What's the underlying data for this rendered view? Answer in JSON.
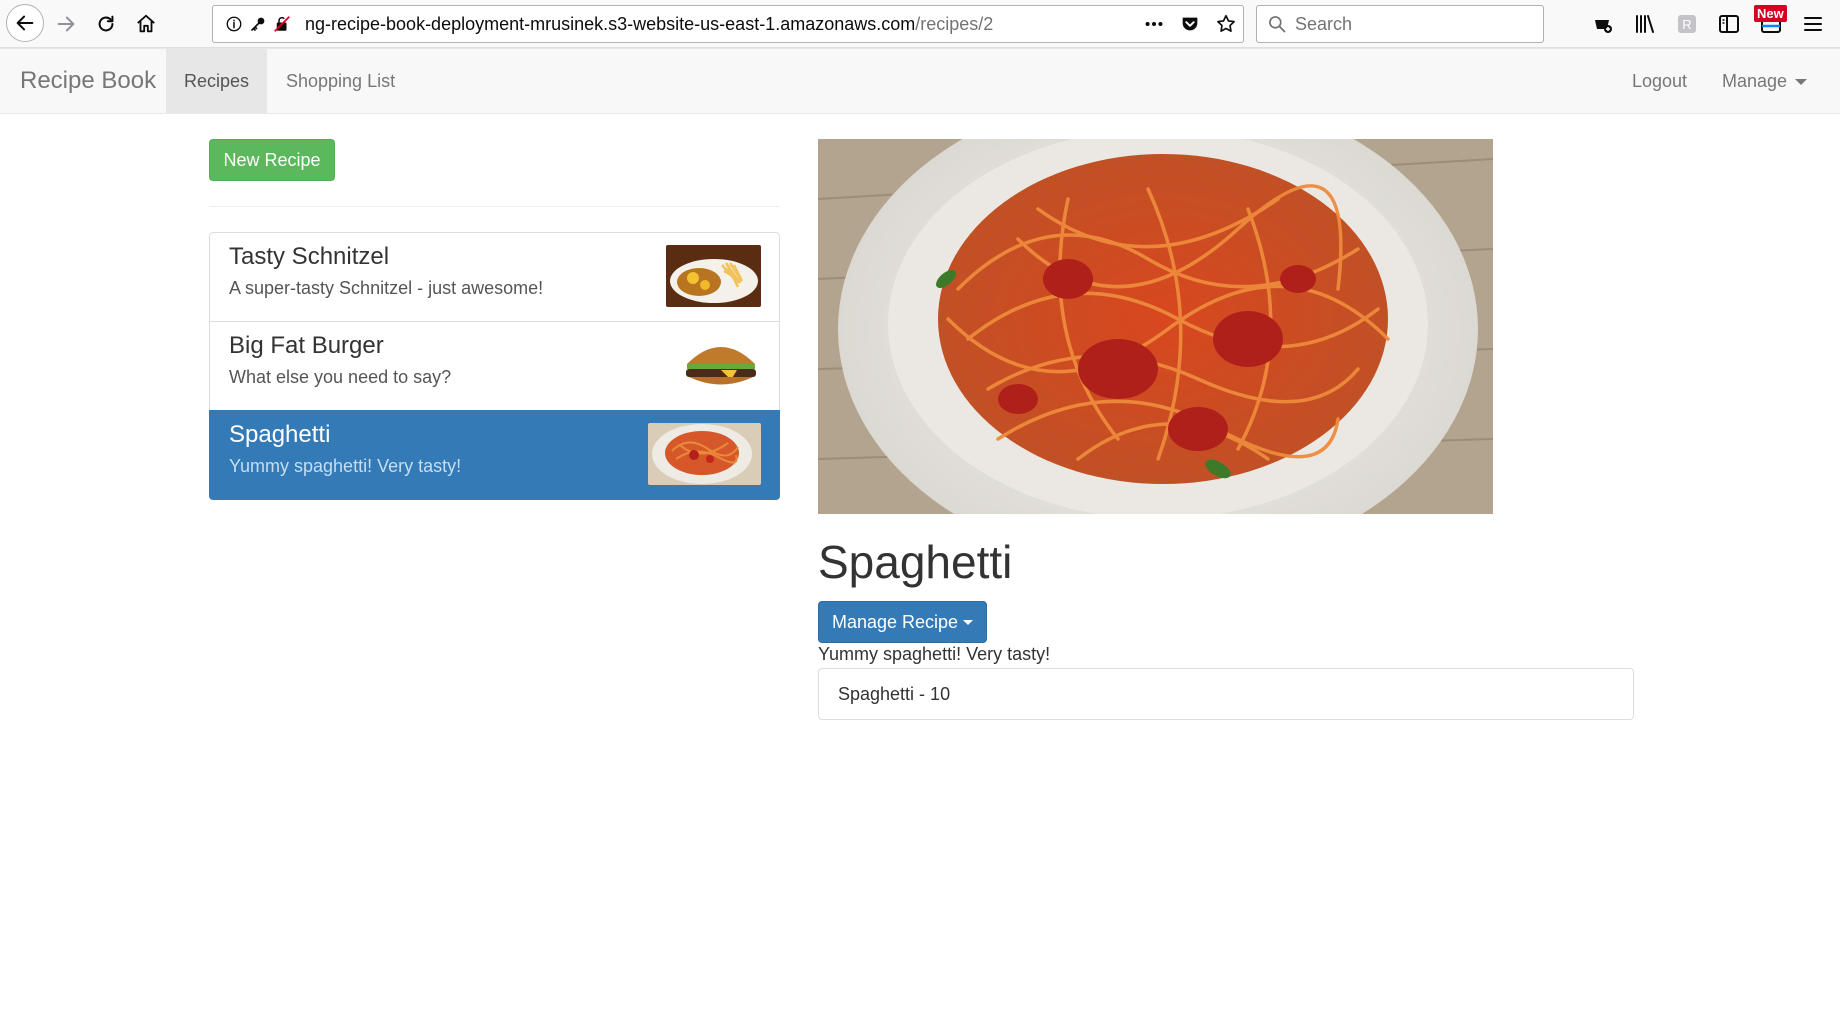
{
  "browser": {
    "url_host": "ng-recipe-book-deployment-mrusinek.s3-website-us-east-1.amazonaws.com",
    "url_path": "/recipes/2",
    "search_placeholder": "Search",
    "new_badge": "New"
  },
  "navbar": {
    "brand": "Recipe Book",
    "recipes_label": "Recipes",
    "shopping_label": "Shopping List",
    "logout_label": "Logout",
    "manage_label": "Manage"
  },
  "recipes": {
    "new_button_label": "New Recipe",
    "items": [
      {
        "name": "Tasty Schnitzel",
        "description": "A super-tasty Schnitzel - just awesome!",
        "thumb": "schnitzel-plate-image",
        "active": false
      },
      {
        "name": "Big Fat Burger",
        "description": "What else you need to say?",
        "thumb": "burger-image",
        "active": false
      },
      {
        "name": "Spaghetti",
        "description": "Yummy spaghetti! Very tasty!",
        "thumb": "spaghetti-bowl-image",
        "active": true
      }
    ]
  },
  "detail": {
    "name": "Spaghetti",
    "manage_button_label": "Manage Recipe",
    "description": "Yummy spaghetti! Very tasty!",
    "ingredients": [
      "Spaghetti - 10"
    ]
  },
  "colors": {
    "success": "#5cb85c",
    "primary": "#337ab7",
    "badge": "#d70022"
  }
}
